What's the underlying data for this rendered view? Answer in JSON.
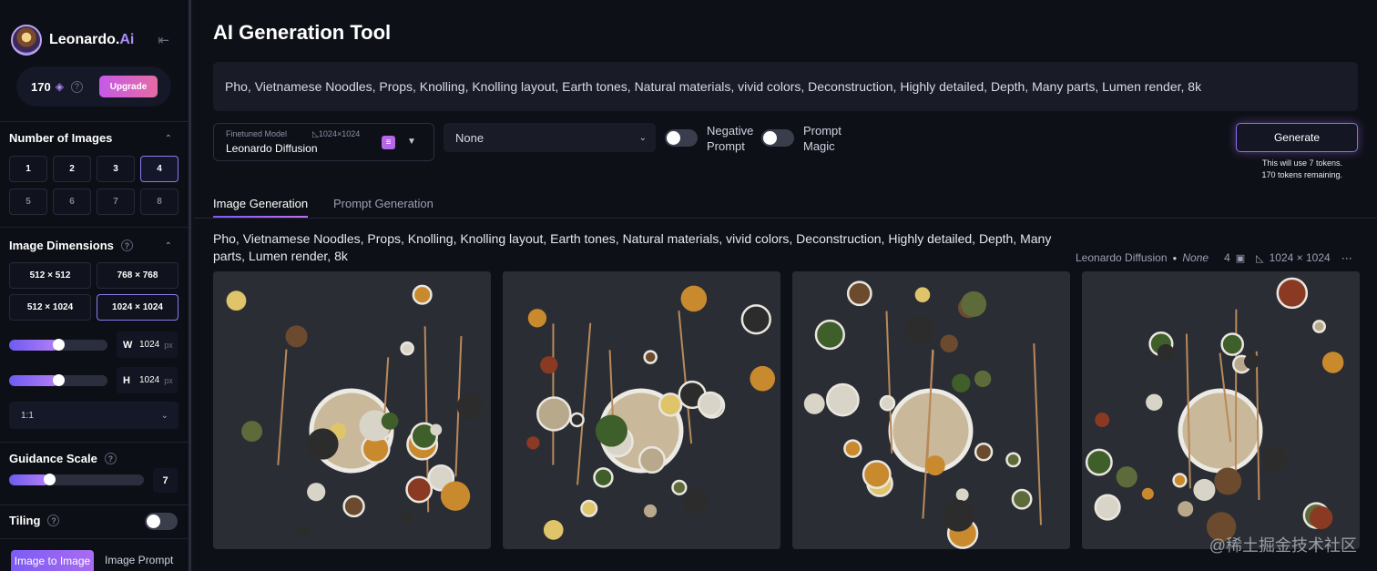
{
  "brand": {
    "name_main": "Leonardo.",
    "name_accent": "Ai"
  },
  "tokens": {
    "count": "170",
    "upgrade_label": "Upgrade"
  },
  "number_of_images": {
    "title": "Number of Images",
    "options": [
      "1",
      "2",
      "3",
      "4",
      "5",
      "6",
      "7",
      "8"
    ],
    "selected": "4"
  },
  "image_dimensions": {
    "title": "Image Dimensions",
    "options": [
      "512 × 512",
      "768 × 768",
      "512 × 1024",
      "1024 × 1024"
    ],
    "selected": "1024 × 1024",
    "width": {
      "label": "W",
      "value": "1024",
      "unit": "px",
      "slider_fraction": 0.5
    },
    "height": {
      "label": "H",
      "value": "1024",
      "unit": "px",
      "slider_fraction": 0.5
    },
    "aspect_ratio": "1:1"
  },
  "guidance_scale": {
    "title": "Guidance Scale",
    "value": "7",
    "slider_fraction": 0.3
  },
  "tiling": {
    "title": "Tiling",
    "enabled": false
  },
  "bottom_tabs": {
    "image_to_image": "Image to Image",
    "image_prompt": "Image Prompt"
  },
  "main": {
    "title": "AI Generation Tool",
    "prompt": "Pho, Vietnamese Noodles, Props, Knolling, Knolling layout, Earth tones, Natural materials, vivid colors, Deconstruction, Highly detailed, Depth, Many parts, Lumen render, 8k",
    "model": {
      "caption": "Finetuned Model",
      "resolution": "1024×1024",
      "name": "Leonardo Diffusion"
    },
    "style": "None",
    "negative_prompt_label": "Negative Prompt",
    "prompt_magic_label": "Prompt Magic",
    "generate_label": "Generate",
    "token_note_1": "This will use 7 tokens.",
    "token_note_2": "170 tokens remaining.",
    "tabs": [
      "Image Generation",
      "Prompt Generation"
    ]
  },
  "result": {
    "prompt": "Pho, Vietnamese Noodles, Props, Knolling, Knolling layout, Earth tones, Natural materials, vivid colors, Deconstruction, Highly detailed, Depth, Many parts, Lumen render, 8k",
    "model": "Leonardo Diffusion",
    "style": "None",
    "count": "4",
    "size": "1024 × 1024"
  },
  "watermark": "@稀土掘金技术社区",
  "colors": {
    "accent": "#8d79f2",
    "background": "#0e1018",
    "sidebar": "#0d0f17"
  },
  "icons": [
    "collapse-icon",
    "coins-icon",
    "help-icon",
    "chevron-up-icon",
    "chevron-down-icon",
    "image-count-icon",
    "resolution-icon",
    "more-icon"
  ]
}
